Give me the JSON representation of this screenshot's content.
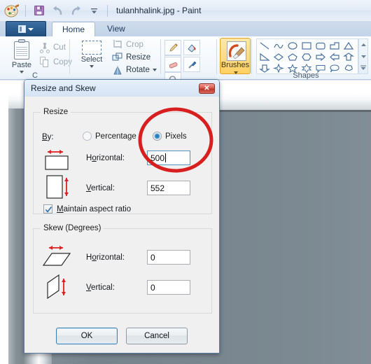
{
  "window": {
    "title": "tulanhhalink.jpg - Paint",
    "app_name": "Paint",
    "file_name": "tulanhhalink.jpg"
  },
  "quick_access": {
    "items": [
      {
        "name": "paint-logo-icon",
        "label": "Paint"
      },
      {
        "name": "save-icon",
        "label": "Save"
      },
      {
        "name": "undo-icon",
        "label": "Undo"
      },
      {
        "name": "redo-icon",
        "label": "Redo"
      },
      {
        "name": "customize-qat-icon",
        "label": "Customize Quick Access Toolbar"
      }
    ]
  },
  "tabs": {
    "file_menu_label": "",
    "items": [
      {
        "label": "Home",
        "active": true
      },
      {
        "label": "View",
        "active": false
      }
    ]
  },
  "ribbon": {
    "groups": [
      {
        "key": "clipboard",
        "label": "C"
      },
      {
        "key": "image",
        "label": ""
      },
      {
        "key": "tools",
        "label": ""
      },
      {
        "key": "brushes",
        "label": ""
      },
      {
        "key": "shapes",
        "label": "Shapes"
      }
    ],
    "clipboard": {
      "paste_label": "Paste",
      "cut_label": "Cut",
      "copy_label": "Copy"
    },
    "image": {
      "select_label": "Select",
      "crop_label": "Crop",
      "resize_label": "Resize",
      "rotate_label": "Rotate"
    },
    "tools": {
      "items": [
        "pencil-icon",
        "fill-with-color-icon",
        "text-icon",
        "eraser-icon",
        "color-picker-icon",
        "magnifier-icon"
      ]
    },
    "brushes": {
      "label": "Brushes"
    },
    "shapes": {
      "items": [
        "line-shape",
        "curve-shape",
        "oval-shape",
        "rectangle-shape",
        "rounded-rectangle-shape",
        "polygon-shape",
        "triangle-shape",
        "right-triangle-shape",
        "diamond-shape",
        "pentagon-shape",
        "hexagon-shape",
        "right-arrow-shape",
        "left-arrow-shape",
        "up-arrow-shape",
        "down-arrow-shape",
        "four-point-star-shape",
        "five-point-star-shape",
        "six-point-star-shape",
        "rounded-rectangular-callout-shape",
        "oval-callout-shape",
        "cloud-callout-shape"
      ],
      "scroll_up": "scroll-up-icon",
      "scroll_down": "scroll-down-icon",
      "expand": "expand-gallery-icon"
    }
  },
  "dialog": {
    "title": "Resize and Skew",
    "close_label": "✕",
    "resize_group": {
      "legend": "Resize",
      "by_label": "By:",
      "by_accel": "B",
      "options": [
        {
          "label": "Percentage",
          "accel": "P",
          "selected": false
        },
        {
          "label": "Pixels",
          "accel": "x",
          "selected": true
        }
      ],
      "horizontal_label": "Horizontal:",
      "horizontal_accel": "o",
      "horizontal_value": "500",
      "horizontal_focused": true,
      "vertical_label": "Vertical:",
      "vertical_accel": "V",
      "vertical_value": "552",
      "maintain_label": "Maintain aspect ratio",
      "maintain_accel": "M",
      "maintain_checked": true,
      "horizontal_icon": "horizontal-resize-icon",
      "vertical_icon": "vertical-resize-icon"
    },
    "skew_group": {
      "legend": "Skew (Degrees)",
      "horizontal_label": "Horizontal:",
      "horizontal_value": "0",
      "vertical_label": "Vertical:",
      "vertical_value": "0",
      "horizontal_icon": "horizontal-skew-icon",
      "vertical_icon": "vertical-skew-icon"
    },
    "buttons": {
      "ok_label": "OK",
      "cancel_label": "Cancel",
      "default_button": "OK"
    }
  },
  "canvas": {
    "image_description": "Photo of a stainless steel refrigerator door"
  },
  "annotation": {
    "type": "ellipse",
    "color": "#d81f1f",
    "stroke_width": 5,
    "encircles": "Pixels radio button and Horizontal value field"
  },
  "colors": {
    "accent_blue": "#2a7bb9",
    "annotation_red": "#d81f1f",
    "brush_highlight": "#ffd064",
    "close_button_red": "#b83427",
    "dialog_face": "#f0f0f0"
  }
}
